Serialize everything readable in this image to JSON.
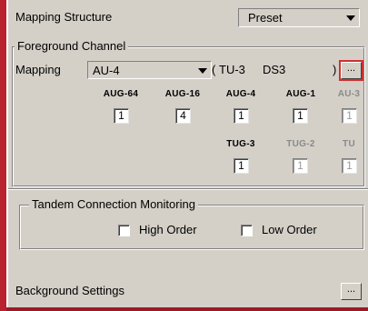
{
  "mapping_structure": {
    "label": "Mapping Structure",
    "value": "Preset"
  },
  "foreground": {
    "title": "Foreground Channel",
    "mapping_label": "Mapping",
    "mapping_value": "AU-4",
    "paren_open": "(",
    "path_1": "TU-3",
    "path_2": "DS3",
    "paren_close": ")",
    "ellipsis": "...",
    "columns": [
      {
        "label": "AUG-64",
        "value": "1",
        "enabled": true
      },
      {
        "label": "AUG-16",
        "value": "4",
        "enabled": true
      },
      {
        "label": "AUG-4",
        "value": "1",
        "enabled": true
      },
      {
        "label": "AUG-1",
        "value": "1",
        "enabled": true
      },
      {
        "label": "AU-3",
        "value": "1",
        "enabled": false
      }
    ],
    "sub_columns": [
      {
        "label": "TUG-3",
        "value": "1",
        "enabled": true
      },
      {
        "label": "TUG-2",
        "value": "1",
        "enabled": false
      },
      {
        "label": "TU",
        "value": "1",
        "enabled": false
      }
    ]
  },
  "tcm": {
    "title": "Tandem Connection Monitoring",
    "high_order": "High Order",
    "low_order": "Low Order"
  },
  "background": {
    "label": "Background Settings",
    "ellipsis": "..."
  },
  "colors": {
    "accent": "#b8232f",
    "focus": "#d03030"
  }
}
